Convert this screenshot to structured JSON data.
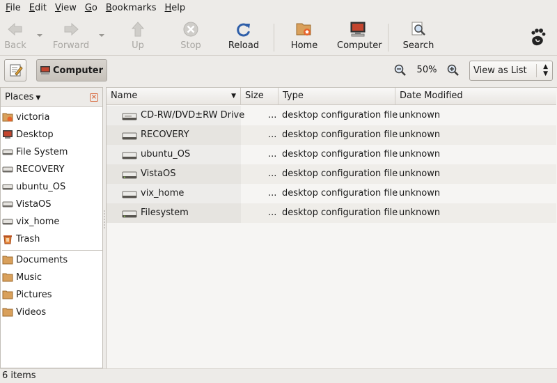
{
  "menubar": {
    "items": [
      {
        "label": "File",
        "mnemonic": "F",
        "rest": "ile"
      },
      {
        "label": "Edit",
        "mnemonic": "E",
        "rest": "dit"
      },
      {
        "label": "View",
        "mnemonic": "V",
        "rest": "iew"
      },
      {
        "label": "Go",
        "mnemonic": "G",
        "rest": "o"
      },
      {
        "label": "Bookmarks",
        "mnemonic": "B",
        "rest": "ookmarks"
      },
      {
        "label": "Help",
        "mnemonic": "H",
        "rest": "elp"
      }
    ]
  },
  "toolbar": {
    "back": "Back",
    "forward": "Forward",
    "up": "Up",
    "stop": "Stop",
    "reload": "Reload",
    "home": "Home",
    "computer": "Computer",
    "search": "Search"
  },
  "location": {
    "breadcrumb": "Computer",
    "zoom": "50%",
    "view_mode": "View as List"
  },
  "sidebar": {
    "header": "Places",
    "items": [
      {
        "label": "victoria",
        "icon": "home-folder-icon"
      },
      {
        "label": "Desktop",
        "icon": "desktop-icon"
      },
      {
        "label": "File System",
        "icon": "drive-icon"
      },
      {
        "label": "RECOVERY",
        "icon": "drive-icon"
      },
      {
        "label": "ubuntu_OS",
        "icon": "drive-icon"
      },
      {
        "label": "VistaOS",
        "icon": "drive-icon"
      },
      {
        "label": "vix_home",
        "icon": "drive-icon"
      },
      {
        "label": "Trash",
        "icon": "trash-icon"
      }
    ],
    "bookmarks": [
      {
        "label": "Documents",
        "icon": "folder-icon"
      },
      {
        "label": "Music",
        "icon": "folder-icon"
      },
      {
        "label": "Pictures",
        "icon": "folder-icon"
      },
      {
        "label": "Videos",
        "icon": "folder-icon"
      }
    ]
  },
  "filelist": {
    "columns": {
      "name": "Name",
      "size": "Size",
      "type": "Type",
      "date": "Date Modified"
    },
    "rows": [
      {
        "name": "CD-RW/DVD±RW Drive",
        "size": "...",
        "type": "desktop configuration file",
        "date": "unknown"
      },
      {
        "name": "RECOVERY",
        "size": "...",
        "type": "desktop configuration file",
        "date": "unknown"
      },
      {
        "name": "ubuntu_OS",
        "size": "...",
        "type": "desktop configuration file",
        "date": "unknown"
      },
      {
        "name": "VistaOS",
        "size": "...",
        "type": "desktop configuration file",
        "date": "unknown"
      },
      {
        "name": "vix_home",
        "size": "...",
        "type": "desktop configuration file",
        "date": "unknown"
      },
      {
        "name": "Filesystem",
        "size": "...",
        "type": "desktop configuration file",
        "date": "unknown"
      }
    ]
  },
  "status": {
    "text": "6 items"
  }
}
